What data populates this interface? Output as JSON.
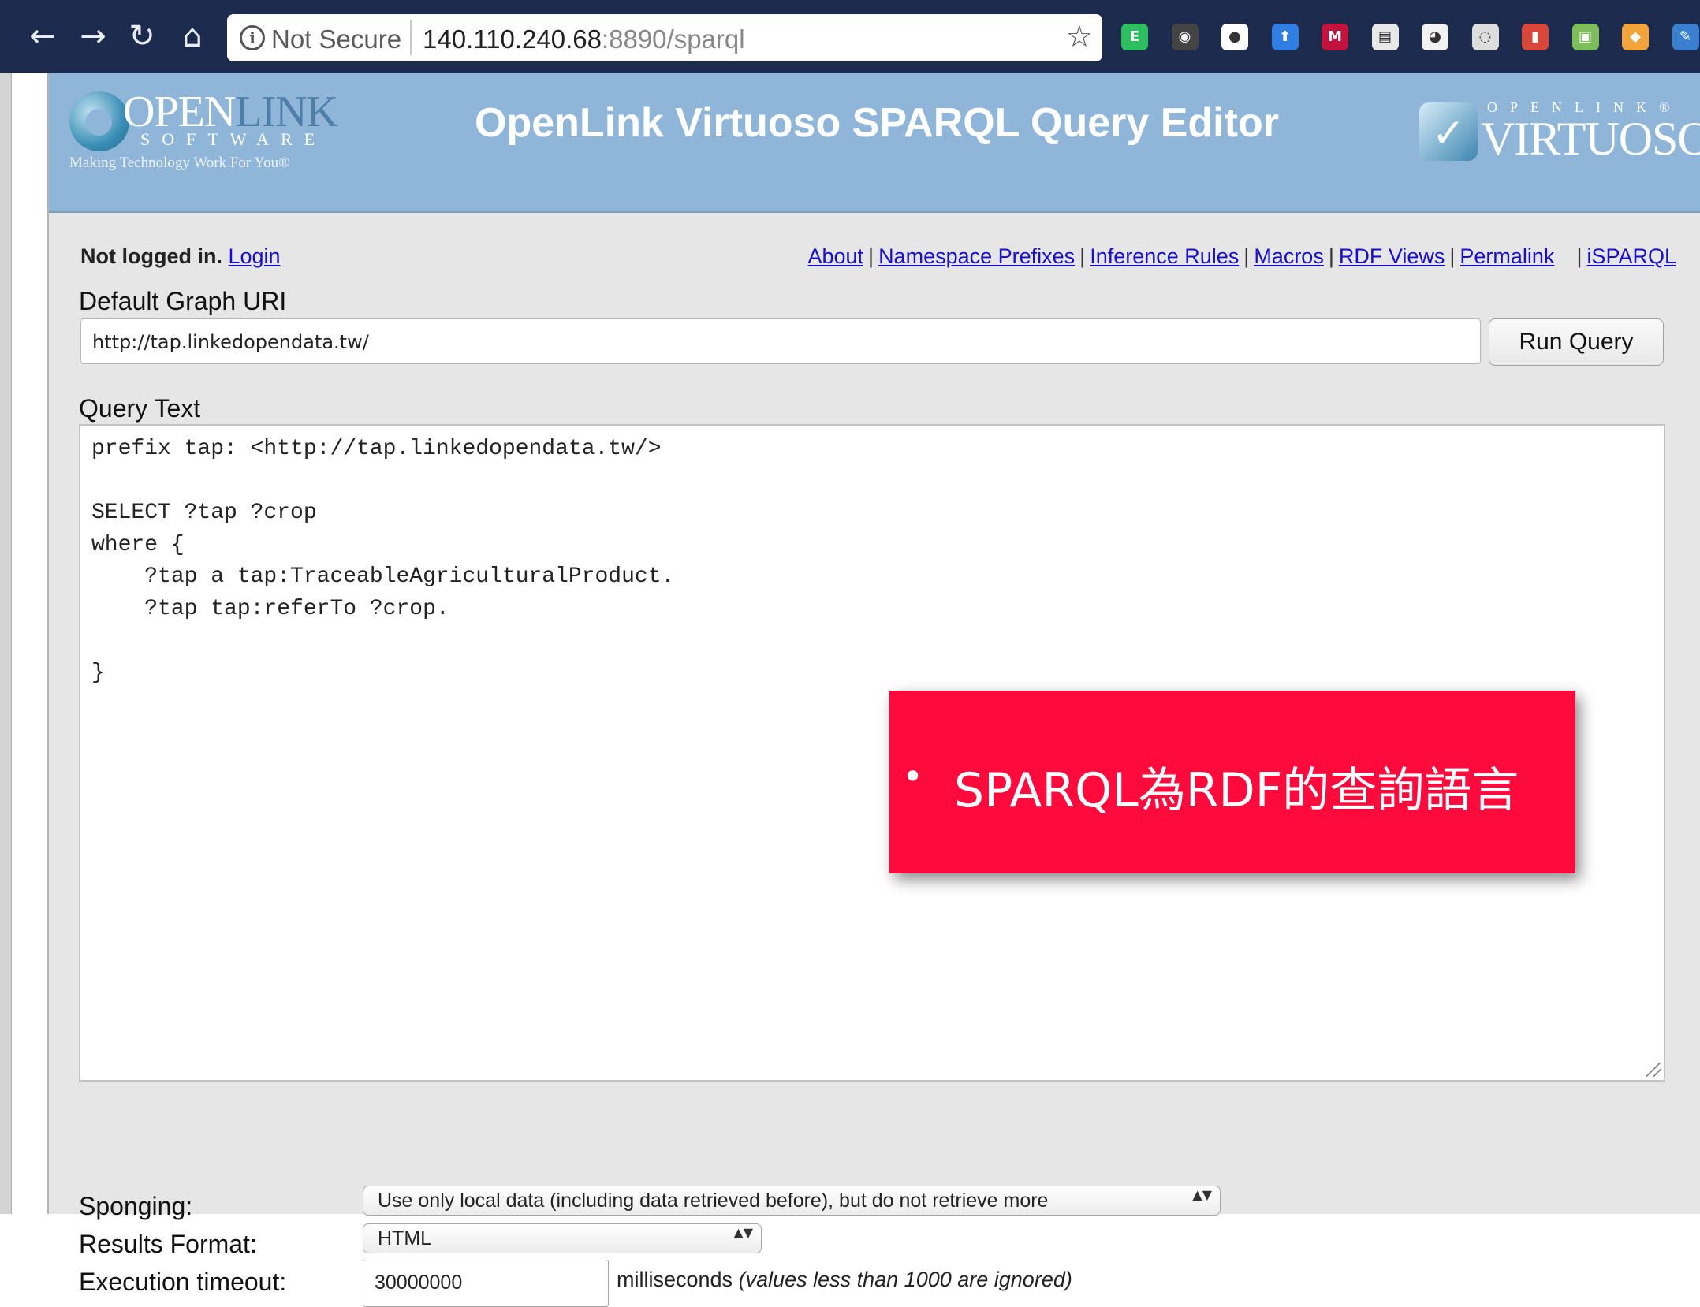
{
  "browser": {
    "back_icon": "←",
    "forward_icon": "→",
    "reload_icon": "↻",
    "home_icon": "⌂",
    "info_icon": "i",
    "security_label": "Not Secure",
    "url_host": "140.110.240.68",
    "url_rest": ":8890/sparql",
    "star_icon": "☆",
    "extensions": [
      {
        "name": "evernote-icon",
        "color": "#2dbe60",
        "glyph": "E"
      },
      {
        "name": "color-wheel-icon",
        "color": "#444444",
        "glyph": "◉"
      },
      {
        "name": "circle-extension-icon",
        "color": "#ffffff",
        "glyph": "●"
      },
      {
        "name": "arrow-up-extension-icon",
        "color": "#2f7fe0",
        "glyph": "⬆"
      },
      {
        "name": "mendeley-icon",
        "color": "#c4123e",
        "glyph": "M"
      },
      {
        "name": "document-icon",
        "color": "#e8e8e8",
        "glyph": "▤"
      },
      {
        "name": "panda-icon",
        "color": "#f2f2f2",
        "glyph": "◕"
      },
      {
        "name": "lightbulb-icon",
        "color": "#dddddd",
        "glyph": "◌"
      },
      {
        "name": "pdf-icon",
        "color": "#d9473a",
        "glyph": "▮"
      },
      {
        "name": "presentation-icon",
        "color": "#7cbf5a",
        "glyph": "▣"
      },
      {
        "name": "package-icon",
        "color": "#f2a33a",
        "glyph": "◆"
      },
      {
        "name": "edit-extension-icon",
        "color": "#3a7fd0",
        "glyph": "✎"
      }
    ]
  },
  "header": {
    "logo_open": "OPEN",
    "logo_link": "LINK",
    "logo_software": "SOFTWARE",
    "logo_tagline": "Making Technology Work For You®",
    "title": "OpenLink Virtuoso SPARQL Query Editor",
    "virtuoso_small": "OPENLINK®",
    "virtuoso_big": "VIRTUOSO"
  },
  "auth": {
    "status": "Not logged in.",
    "login_link": "Login"
  },
  "top_links": [
    "About",
    "Namespace Prefixes",
    "Inference Rules",
    "Macros",
    "RDF Views",
    "Permalink",
    "iSPARQL"
  ],
  "graph": {
    "label": "Default Graph URI",
    "value": "http://tap.linkedopendata.tw/",
    "run_button": "Run Query"
  },
  "query": {
    "label": "Query Text",
    "text": "prefix tap: <http://tap.linkedopendata.tw/>\n\nSELECT ?tap ?crop\nwhere {\n    ?tap a tap:TraceableAgriculturalProduct.\n    ?tap tap:referTo ?crop.\n\n}"
  },
  "overlay": {
    "bullet": "•",
    "text": "SPARQL為RDF的查詢語言"
  },
  "options": {
    "sponging_label": "Sponging:",
    "sponging_value": "Use only local data (including data retrieved before), but do not retrieve more",
    "format_label": "Results Format:",
    "format_value": "HTML",
    "timeout_label": "Execution timeout:",
    "timeout_value": "30000000",
    "timeout_unit": "milliseconds",
    "timeout_note": "(values less than 1000 are ignored)",
    "select_arrows": "▲▼"
  }
}
